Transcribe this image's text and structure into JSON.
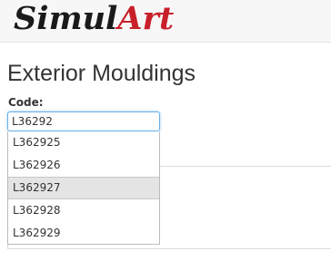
{
  "header": {
    "logo_part1": "Simul",
    "logo_part2": "Art"
  },
  "main": {
    "title": "Exterior Mouldings",
    "code_label": "Code:",
    "code_value": "L36292"
  },
  "autocomplete": {
    "active_index": 2,
    "items": [
      {
        "label": "L362925"
      },
      {
        "label": "L362926"
      },
      {
        "label": "L362927"
      },
      {
        "label": "L362928"
      },
      {
        "label": "L362929"
      }
    ]
  },
  "colors": {
    "brand_dark": "#1a1a1a",
    "brand_accent": "#c8202a",
    "focus_border": "#66afe9",
    "highlight": "#e4e4e4"
  }
}
